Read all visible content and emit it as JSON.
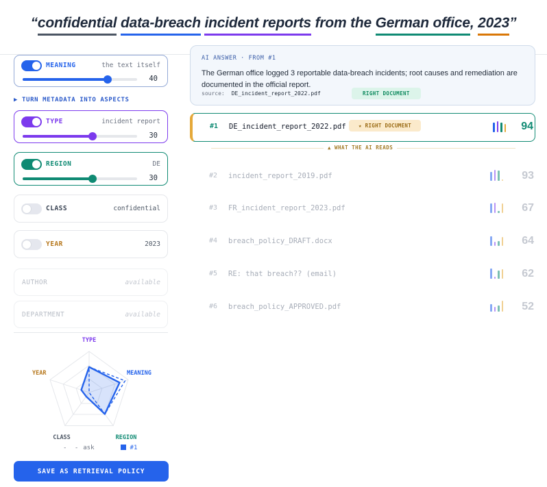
{
  "query": {
    "open_quote": "“",
    "close_quote": "”",
    "segments": [
      {
        "text": "confidential",
        "class": "u-class"
      },
      {
        "text": " ",
        "class": ""
      },
      {
        "text": "data-breach",
        "class": "u-meaning"
      },
      {
        "text": " ",
        "class": ""
      },
      {
        "text": "incident reports",
        "class": "u-type"
      },
      {
        "text": " from the ",
        "class": ""
      },
      {
        "text": "German office",
        "class": "u-region"
      },
      {
        "text": ", ",
        "class": ""
      },
      {
        "text": "2023",
        "class": "u-year"
      }
    ]
  },
  "aspects": {
    "meaning": {
      "label": "MEANING",
      "value": "the text itself",
      "weight": 40,
      "fraction": 0.74,
      "color": "#2563eb",
      "enabled": true
    },
    "turn_metadata": "TURN METADATA INTO ASPECTS",
    "type": {
      "label": "TYPE",
      "value": "incident report",
      "weight": 30,
      "fraction": 0.61,
      "color": "#7c3aed",
      "enabled": true
    },
    "region": {
      "label": "REGION",
      "value": "DE",
      "weight": 30,
      "fraction": 0.61,
      "color": "#0f8a73",
      "enabled": true
    },
    "class": {
      "label": "CLASS",
      "value": "confidential",
      "enabled": false,
      "label_color": "#374151"
    },
    "year": {
      "label": "YEAR",
      "value": "2023",
      "enabled": false,
      "label_color": "#b7791f"
    },
    "author": {
      "label": "AUTHOR",
      "value": "available"
    },
    "department": {
      "label": "DEPARTMENT",
      "value": "available"
    }
  },
  "radar": {
    "labels": {
      "type": "TYPE",
      "meaning": "MEANING",
      "region": "REGION",
      "class": "CLASS",
      "year": "YEAR"
    },
    "label_colors": {
      "type": "#7c3aed",
      "meaning": "#2563eb",
      "region": "#0f8a73",
      "class": "#4b5563",
      "year": "#b7791f"
    },
    "order": [
      "type",
      "meaning",
      "region",
      "class",
      "year"
    ],
    "ask": [
      0.62,
      0.92,
      0.65,
      0.0,
      0.0
    ],
    "result_1": [
      0.62,
      0.78,
      0.65,
      0.12,
      0.2
    ]
  },
  "legend": {
    "dash": "- -",
    "ask": "ask",
    "result": "#1"
  },
  "save_button": "SAVE AS RETRIEVAL POLICY",
  "answer": {
    "header": "AI ANSWER · FROM #1",
    "text": "The German office logged 3 reportable data-breach incidents; root causes and remediation are documented in the official report.",
    "source_label": "source:",
    "source_file": "DE_incident_report_2022.pdf",
    "badge": "RIGHT DOCUMENT"
  },
  "results": [
    {
      "rank": "#1",
      "file": "DE_incident_report_2022.pdf",
      "score": "94",
      "badge": "★ RIGHT DOCUMENT",
      "bars": [
        0.85,
        1.0,
        0.9,
        0.75
      ]
    },
    {
      "rank": "#2",
      "file": "incident_report_2019.pdf",
      "score": "93",
      "bars": [
        0.8,
        1.0,
        0.95,
        0.15
      ]
    },
    {
      "rank": "#3",
      "file": "FR_incident_report_2023.pdf",
      "score": "67",
      "bars": [
        0.85,
        0.95,
        0.2,
        0.9
      ]
    },
    {
      "rank": "#4",
      "file": "breach_policy_DRAFT.docx",
      "score": "64",
      "bars": [
        0.9,
        0.35,
        0.45,
        0.8
      ]
    },
    {
      "rank": "#5",
      "file": "RE: that breach?? (email)",
      "score": "62",
      "bars": [
        0.95,
        0.2,
        0.75,
        0.85
      ]
    },
    {
      "rank": "#6",
      "file": "breach_policy_APPROVED.pdf",
      "score": "52",
      "bars": [
        0.7,
        0.45,
        0.55,
        1.0
      ]
    }
  ],
  "bar_colors": [
    "#2563eb",
    "#7c3aed",
    "#0f8a73",
    "#e5a93a"
  ],
  "ai_reads": "▲ WHAT THE AI READS"
}
